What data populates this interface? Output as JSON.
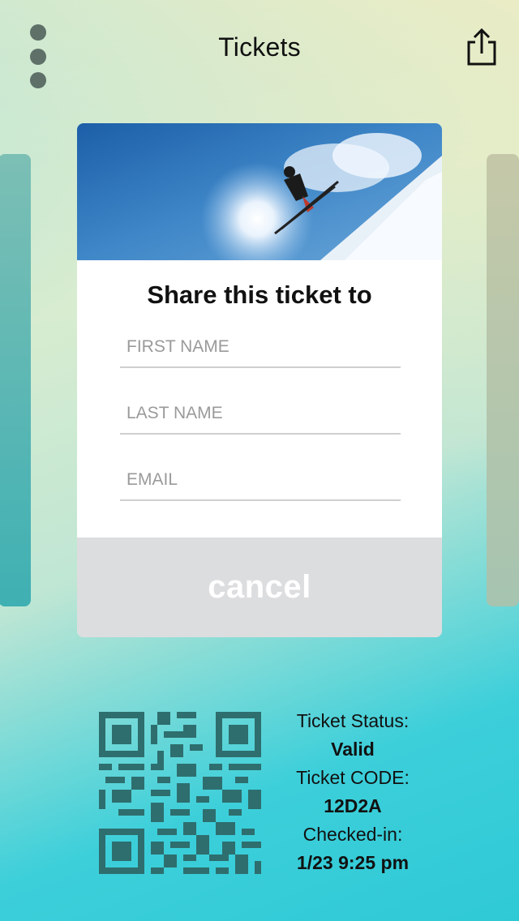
{
  "header": {
    "title": "Tickets"
  },
  "share_form": {
    "heading": "Share this ticket to",
    "first_name_placeholder": "FIRST NAME",
    "last_name_placeholder": "LAST NAME",
    "email_placeholder": "EMAIL",
    "cancel_label": "cancel"
  },
  "ticket": {
    "status_label": "Ticket Status:",
    "status_value": "Valid",
    "code_label": "Ticket CODE:",
    "code_value": "12D2A",
    "checked_in_label": "Checked-in:",
    "checked_in_value": "1/23 9:25 pm"
  },
  "icons": {
    "menu": "vertical-dots-icon",
    "share": "share-icon"
  },
  "colors": {
    "qr": "#2e6e6e",
    "menu_dots": "#5e7068",
    "cancel_bg": "#dcdddf"
  }
}
